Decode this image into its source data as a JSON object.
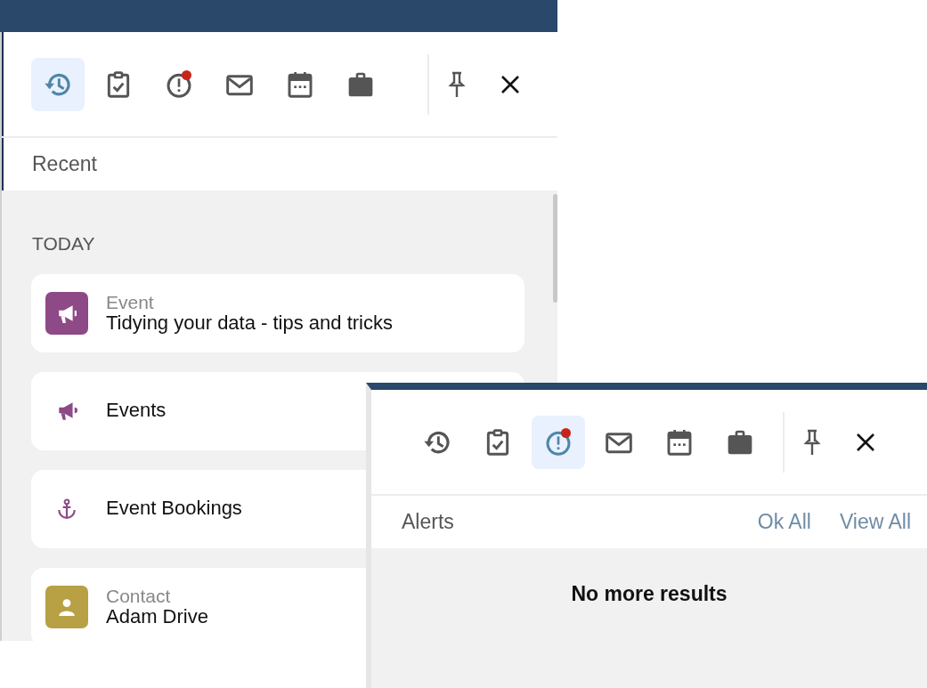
{
  "panels": [
    {
      "toolbar": {
        "tabs": [
          {
            "kind": "history",
            "selected": true,
            "badge": false
          },
          {
            "kind": "tasks",
            "selected": false,
            "badge": false
          },
          {
            "kind": "alerts",
            "selected": false,
            "badge": true
          },
          {
            "kind": "mail",
            "selected": false,
            "badge": false
          },
          {
            "kind": "calendar",
            "selected": false,
            "badge": false
          },
          {
            "kind": "briefcase",
            "selected": false,
            "badge": false
          }
        ]
      },
      "title": "Recent",
      "sections": [
        {
          "heading": "TODAY",
          "items": [
            {
              "kind": "event",
              "color": "#8e4a86",
              "type_label": "Event",
              "name": "Tidying your data - tips and tricks"
            },
            {
              "kind": "events",
              "color": "#8e4a86",
              "name": "Events"
            },
            {
              "kind": "bookings",
              "color": "#8e4a86",
              "name": "Event Bookings"
            },
            {
              "kind": "contact",
              "color": "#b8a044",
              "type_label": "Contact",
              "name": "Adam Drive"
            }
          ]
        }
      ]
    },
    {
      "toolbar": {
        "tabs": [
          {
            "kind": "history",
            "selected": false,
            "badge": false
          },
          {
            "kind": "tasks",
            "selected": false,
            "badge": false
          },
          {
            "kind": "alerts",
            "selected": true,
            "badge": true
          },
          {
            "kind": "mail",
            "selected": false,
            "badge": false
          },
          {
            "kind": "calendar",
            "selected": false,
            "badge": false
          },
          {
            "kind": "briefcase",
            "selected": false,
            "badge": false
          }
        ]
      },
      "title": "Alerts",
      "actions": [
        "Ok All",
        "View All"
      ],
      "message": "No more results"
    }
  ]
}
